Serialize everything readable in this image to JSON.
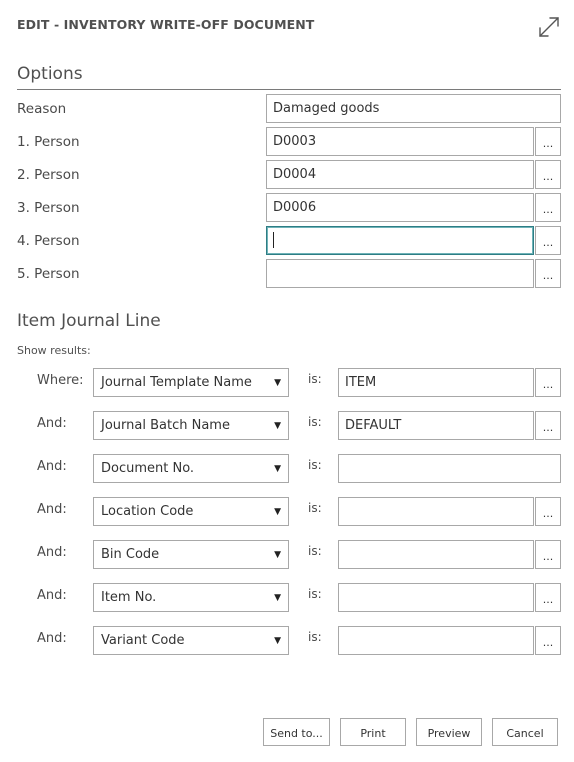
{
  "dialog": {
    "title": "EDIT - INVENTORY WRITE-OFF DOCUMENT"
  },
  "options": {
    "title": "Options",
    "fields": [
      {
        "label": "Reason",
        "value": "Damaged goods"
      },
      {
        "label": "1. Person",
        "value": "D0003"
      },
      {
        "label": "2. Person",
        "value": "D0004"
      },
      {
        "label": "3. Person",
        "value": "D0006"
      },
      {
        "label": "4. Person",
        "value": ""
      },
      {
        "label": "5. Person",
        "value": ""
      }
    ],
    "lookup_label": "..."
  },
  "item_journal": {
    "title": "Item Journal Line",
    "show_results": "Show results:",
    "is_label": "is:",
    "filters": [
      {
        "prefix": "Where:",
        "field": "Journal Template Name",
        "value": "ITEM"
      },
      {
        "prefix": "And:",
        "field": "Journal Batch Name",
        "value": "DEFAULT"
      },
      {
        "prefix": "And:",
        "field": "Document No.",
        "value": ""
      },
      {
        "prefix": "And:",
        "field": "Location Code",
        "value": ""
      },
      {
        "prefix": "And:",
        "field": "Bin Code",
        "value": ""
      },
      {
        "prefix": "And:",
        "field": "Item No.",
        "value": ""
      },
      {
        "prefix": "And:",
        "field": "Variant Code",
        "value": ""
      }
    ]
  },
  "buttons": {
    "send_to": "Send to...",
    "print": "Print",
    "preview": "Preview",
    "cancel": "Cancel"
  },
  "colors": {
    "focus_border": "#2e7d84",
    "border": "#a8a8a8",
    "text": "#333333"
  },
  "icons": {
    "expand": "expand-arrows-icon",
    "dropdown": "triangle-down-icon"
  }
}
